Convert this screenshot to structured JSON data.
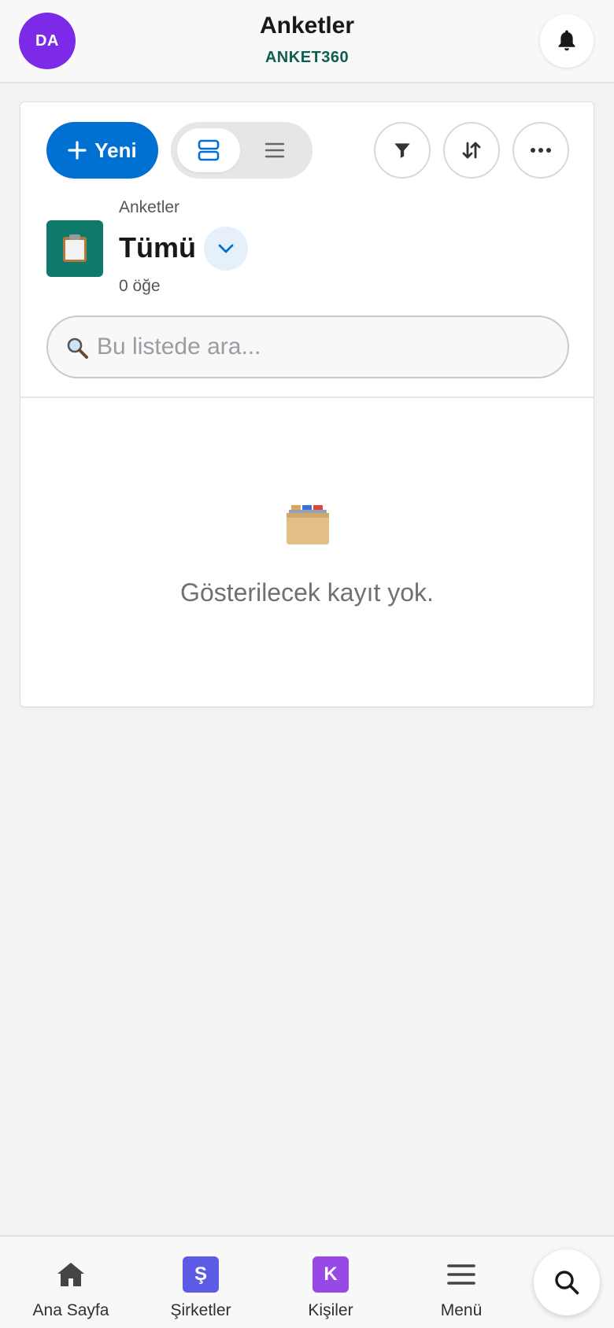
{
  "header": {
    "avatar_initials": "DA",
    "avatar_color": "#7c2ae8",
    "title": "Anketler",
    "subtitle": "ANKET360",
    "subtitle_color": "#0d5f52",
    "notification_icon": "bell-icon"
  },
  "toolbar": {
    "new_button_label": "Yeni",
    "new_button_color": "#0070d2",
    "view_modes": [
      {
        "name": "card-view-icon",
        "active": true
      },
      {
        "name": "list-view-icon",
        "active": false
      }
    ],
    "filter_icon": "filter-icon",
    "sort_icon": "sort-icon",
    "more_icon": "more-horizontal-icon"
  },
  "list_header": {
    "breadcrumb": "Anketler",
    "view_name": "Tümü",
    "item_count": "0 öğe",
    "icon": "clipboard-icon",
    "icon_color": "#0f7a6c"
  },
  "search": {
    "placeholder": "Bu listede ara...",
    "value": ""
  },
  "empty_state": {
    "icon": "card-file-box-icon",
    "message": "Gösterilecek kayıt yok."
  },
  "bottom_nav": {
    "items": [
      {
        "label": "Ana Sayfa",
        "icon": "home-icon"
      },
      {
        "label": "Şirketler",
        "badge": "Ş",
        "badge_color": "#5b5be6"
      },
      {
        "label": "Kişiler",
        "badge": "K",
        "badge_color": "#9748e6"
      },
      {
        "label": "Menü",
        "icon": "menu-icon"
      }
    ],
    "search_icon": "search-icon"
  }
}
